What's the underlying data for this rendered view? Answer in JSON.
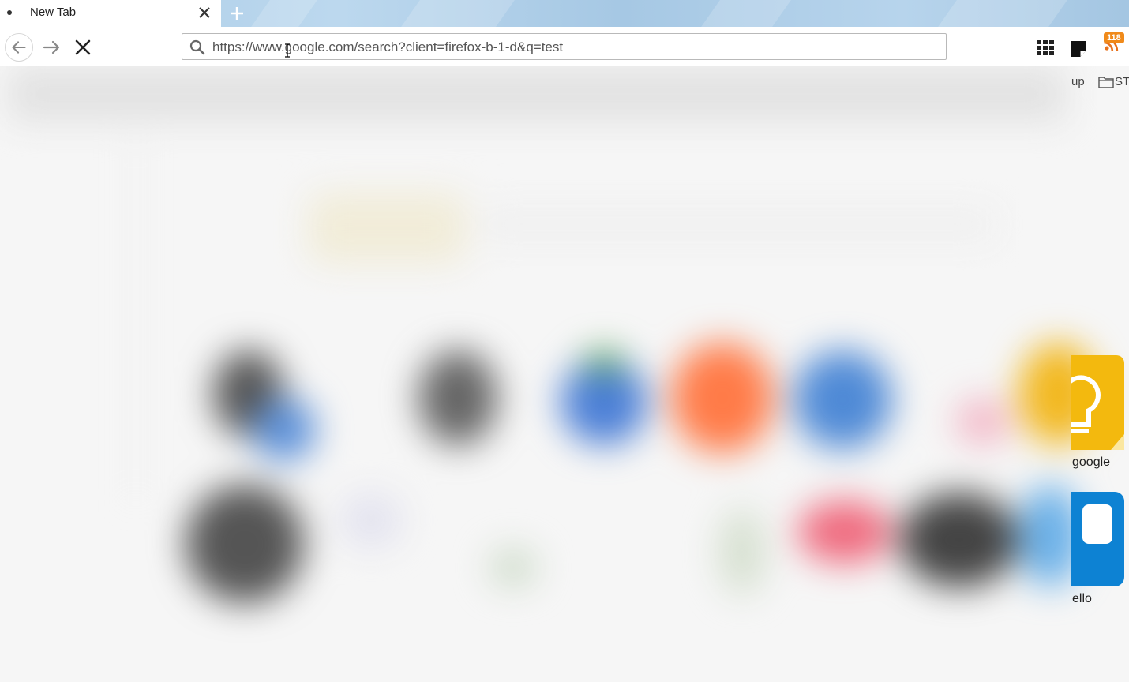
{
  "tab": {
    "title": "New Tab"
  },
  "url": {
    "value": "https://www.google.com/search?client=firefox-b-1-d&q=test"
  },
  "toolbar": {
    "badge_count": "118"
  },
  "bookmarks": {
    "item1": "up",
    "item2": "ST"
  },
  "tiles": [
    {
      "label": "google",
      "color": "#f3b90e"
    },
    {
      "label": "ello",
      "color": "#0d82d3"
    }
  ],
  "icons": [
    "back-arrow-icon",
    "forward-arrow-icon",
    "stop-icon",
    "search-icon",
    "apps-grid-icon",
    "sticky-note-icon",
    "rss-icon",
    "folder-icon",
    "text-cursor-icon"
  ]
}
